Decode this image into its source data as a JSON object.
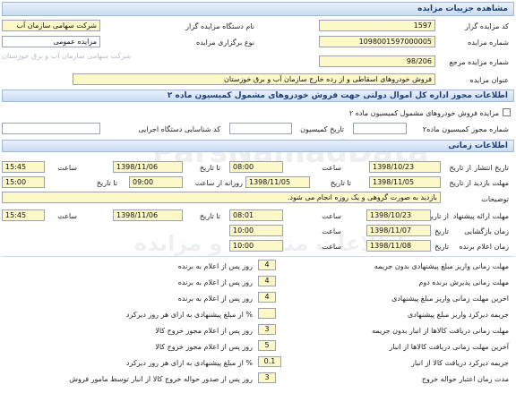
{
  "header": {
    "title": "مشاهده جزییات مزایده"
  },
  "details": {
    "code_label": "کد مزایده گزار",
    "code_value": "1597",
    "org_name_label": "نام دستگاه مزایده گزار",
    "org_name_value": "شرکت سهامی سازمان آب",
    "number_label": "شماره مزایده",
    "number_value": "1098001597000005",
    "type_label": "نوع برگزاری مزایده",
    "type_value": "مزایده عمومی",
    "org_sub_value": "شرکت سهامی سازمان آب و برق خوزستان",
    "ref_label": "شماره مزایده مرجع",
    "ref_value": "98/206",
    "title_label": "عنوان مزایده",
    "title_value": "فروش خودروهای اسقاطی و از رده خارج سازمان آب و برق خوزستان"
  },
  "permit": {
    "header": "اطلاعات مجوز اداره کل اموال دولتی جهت فروش خودروهای مشمول کمیسیون ماده ۲",
    "checkbox_label": "مزایده فروش خودروهای مشمول کمیسیون ماده ۲",
    "number_label": "شماره مجوز کمیسیون ماده۲",
    "date_label": "تاریخ کمیسیون",
    "id_label": "کد شناسایی دستگاه اجرایی"
  },
  "timing": {
    "header": "اطلاعات زمانی",
    "publish_label": "تاریخ انتشار",
    "from_label": "از تاریخ",
    "to_label": "تا تاریخ",
    "time_label": "ساعت",
    "publish_from_date": "1398/10/23",
    "publish_from_time": "08:00",
    "publish_to_date": "1398/11/06",
    "publish_to_time": "15:45",
    "visit_label": "مهلت بازدید",
    "visit_from_date": "1398/11/05",
    "visit_to_date": "1398/11/05",
    "daily_label": "روزانه از ساعت",
    "visit_from_time": "09:00",
    "visit_to_time": "15:00",
    "desc_label": "توضیحات",
    "desc_value": "بازدید به صورت گروهی و یک روزه انجام می شود.",
    "offer_label": "مهلت ارائه پیشنهاد",
    "offer_from_date": "1398/10/23",
    "offer_from_time": "08:01",
    "offer_to_date": "1398/11/06",
    "offer_to_time": "15:45",
    "opening_label": "زمان بازگشایی",
    "date_label": "تاریخ",
    "opening_date": "1398/11/07",
    "opening_time": "10:00",
    "winner_label": "زمان اعلام برنده",
    "winner_date": "1398/11/08",
    "winner_time": "10:00"
  },
  "terms": [
    {
      "label": "مهلت زمانی واریز مبلغ پیشنهادی بدون جریمه",
      "value": "4",
      "unit": "روز پس از اعلام به برنده"
    },
    {
      "label": "مهلت زمانی پذیرش برنده دوم",
      "value": "4",
      "unit": "روز پس از اعلام به برنده"
    },
    {
      "label": "اخرین مهلت زمانی واریز مبلغ پیشنهادی",
      "value": "4",
      "unit": "روز پس از اعلام به برنده"
    },
    {
      "label": "جریمه دیرکرد واریز مبلغ پیشنهادی",
      "value": "",
      "unit": "% از مبلغ پیشنهادی به ازای هر روز دیرکرد"
    },
    {
      "label": "مهلت زمانی دریافت کالاها از انبار بدون جریمه",
      "value": "3",
      "unit": "روز پس از اعلام مجوز خروج کالا"
    },
    {
      "label": "آخرین مهلت زمانی دریافت کالاها از انبار",
      "value": "5",
      "unit": "روز پس از اعلام مجوز خروج کالا"
    },
    {
      "label": "جریمه دیرکرد دریافت کالا از انبار",
      "value": "0.1",
      "unit": "% از مبلغ پیشنهادی به ازای هر روز دیرکرد"
    },
    {
      "label": "مدت زمان اعتبار حواله خروج",
      "value": "3",
      "unit": "روز پس از صدور حواله خروج کالا از انبار توسط مامور فروش"
    }
  ]
}
